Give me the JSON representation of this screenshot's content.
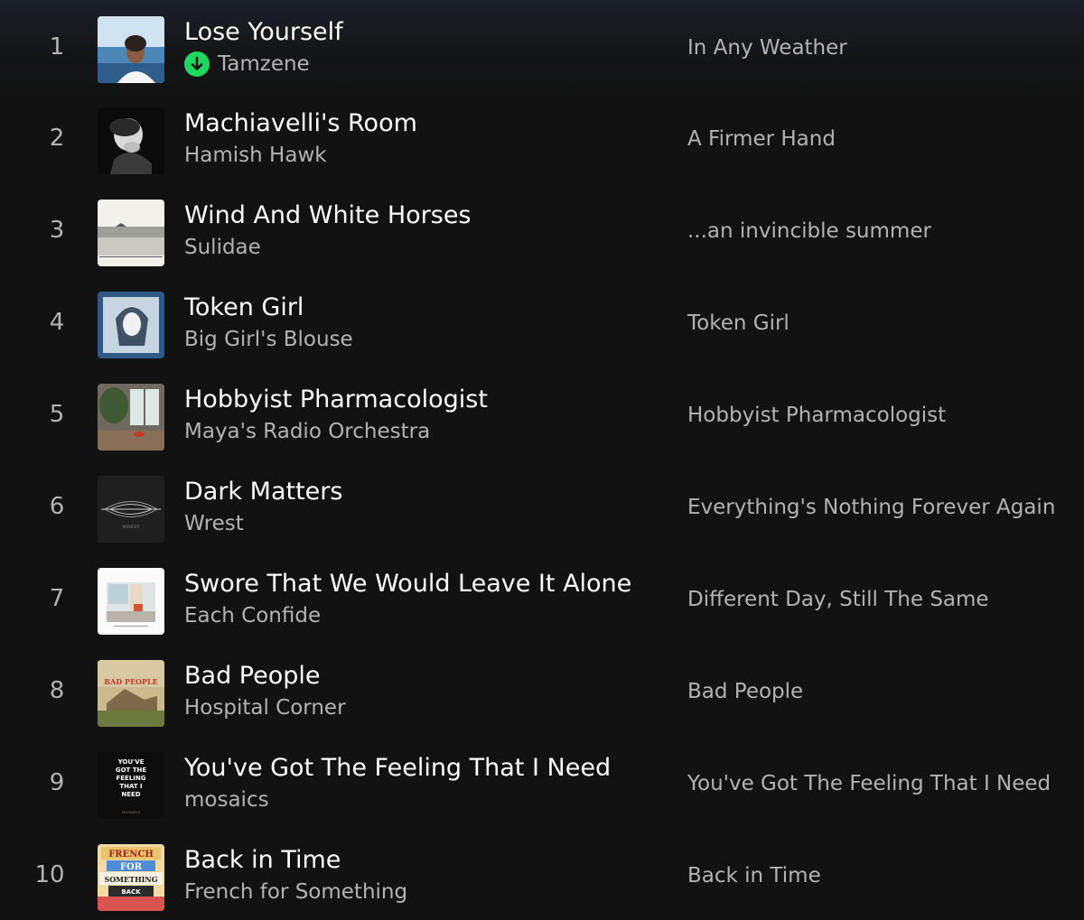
{
  "tracks": [
    {
      "index": "1",
      "title": "Lose Yourself",
      "artist": "Tamzene",
      "album": "In Any Weather",
      "downloaded": true,
      "cover_icon": "portrait-sea-cover"
    },
    {
      "index": "2",
      "title": "Machiavelli's Room",
      "artist": "Hamish Hawk",
      "album": "A Firmer Hand",
      "downloaded": false,
      "cover_icon": "bw-portrait-cover"
    },
    {
      "index": "3",
      "title": "Wind And White Horses",
      "artist": "Sulidae",
      "album": "...an invincible summer",
      "downloaded": false,
      "cover_icon": "seascape-cover"
    },
    {
      "index": "4",
      "title": "Token Girl",
      "artist": "Big Girl's Blouse",
      "album": "Token Girl",
      "downloaded": false,
      "cover_icon": "blue-portrait-cover"
    },
    {
      "index": "5",
      "title": "Hobbyist Pharmacologist",
      "artist": "Maya's Radio Orchestra",
      "album": "Hobbyist Pharmacologist",
      "downloaded": false,
      "cover_icon": "room-plants-cover"
    },
    {
      "index": "6",
      "title": "Dark Matters",
      "artist": "Wrest",
      "album": "Everything's Nothing Forever Again",
      "downloaded": false,
      "cover_icon": "waveform-cover",
      "cover_text": "WREST"
    },
    {
      "index": "7",
      "title": "Swore That We Would Leave It Alone",
      "artist": "Each Confide",
      "album": "Different Day, Still The Same",
      "downloaded": false,
      "cover_icon": "interior-cover"
    },
    {
      "index": "8",
      "title": "Bad People",
      "artist": "Hospital Corner",
      "album": "Bad People",
      "downloaded": false,
      "cover_icon": "house-cover",
      "cover_text": "BAD PEOPLE"
    },
    {
      "index": "9",
      "title": "You've Got The Feeling That I Need",
      "artist": "mosaics",
      "album": "You've Got The Feeling That I Need",
      "downloaded": false,
      "cover_icon": "text-cover",
      "cover_lines": [
        "YOU'VE",
        "GOT THE",
        "FEELING",
        "THAT I",
        "NEED"
      ],
      "cover_footer": "mosaics"
    },
    {
      "index": "10",
      "title": "Back in Time",
      "artist": "French for Something",
      "album": "Back in Time",
      "downloaded": false,
      "cover_icon": "collage-cover",
      "cover_lines": [
        "FRENCH",
        "FOR",
        "SOMETHING",
        "BACK"
      ]
    }
  ],
  "colors": {
    "background": "#121212",
    "title_text": "#ffffff",
    "secondary_text": "#b3b3b3",
    "download_badge": "#1ed760"
  }
}
